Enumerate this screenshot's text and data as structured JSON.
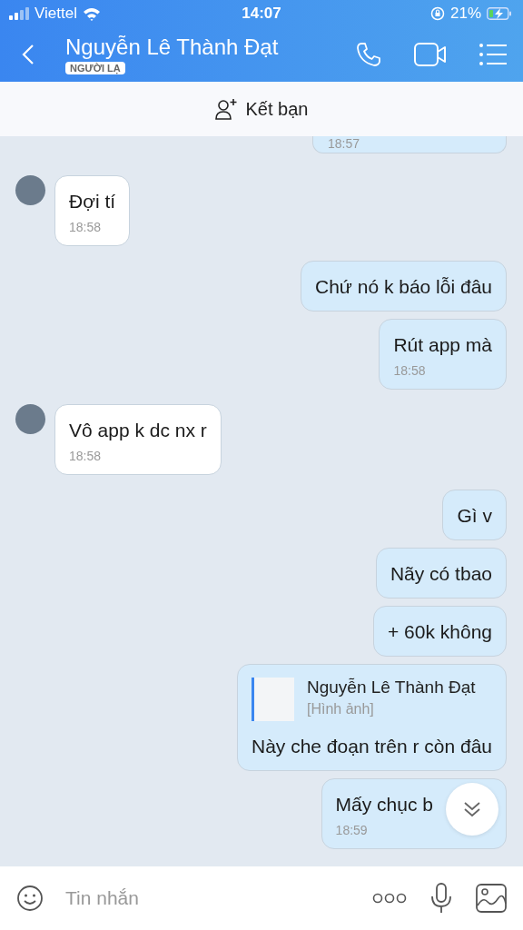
{
  "status_bar": {
    "carrier": "Viettel",
    "time": "14:07",
    "battery": "21%"
  },
  "header": {
    "title": "Nguyễn Lê Thành Đạt",
    "badge": "NGƯỜI LẠ"
  },
  "add_friend": {
    "label": "Kết bạn"
  },
  "messages": [
    {
      "kind": "outgoing",
      "time": "18:57",
      "cut": true
    },
    {
      "kind": "incoming",
      "text": "Đợi tí",
      "time": "18:58",
      "avatar": true
    },
    {
      "kind": "outgoing",
      "text": "Chứ nó k báo lỗi đâu"
    },
    {
      "kind": "outgoing",
      "text": "Rút app mà",
      "time": "18:58"
    },
    {
      "kind": "incoming",
      "text": "Vô app k dc nx r",
      "time": "18:58",
      "avatar": true
    },
    {
      "kind": "outgoing",
      "text": "Gì v"
    },
    {
      "kind": "outgoing",
      "text": "Nãy có tbao"
    },
    {
      "kind": "outgoing",
      "text": "+ 60k không"
    },
    {
      "kind": "outgoing",
      "text": "Này che đoạn trên r còn đâu",
      "quote": {
        "name": "Nguyễn Lê Thành Đạt",
        "type": "[Hình ảnh]"
      }
    },
    {
      "kind": "outgoing",
      "text": "Mấy chục b",
      "time": "18:59",
      "scroll_button": true
    }
  ],
  "composer": {
    "placeholder": "Tin nhắn"
  }
}
